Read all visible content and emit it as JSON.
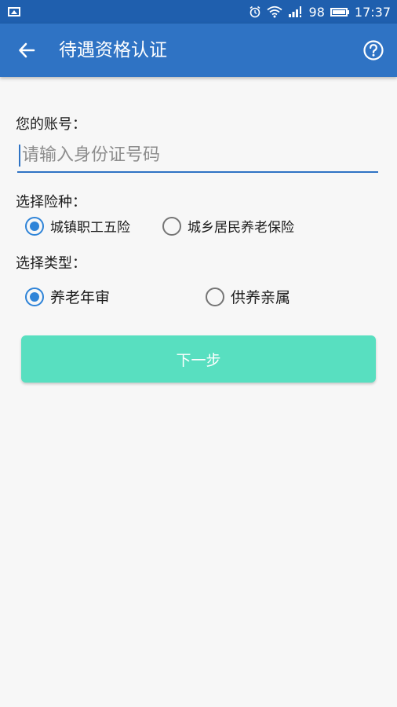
{
  "status_bar": {
    "battery_level": "98",
    "time": "17:37",
    "icons": [
      "image-icon",
      "alarm-icon",
      "wifi-icon",
      "signal-icon",
      "battery-icon"
    ]
  },
  "app_bar": {
    "title": "待遇资格认证",
    "icons": [
      "back-arrow-icon",
      "help-icon"
    ]
  },
  "account": {
    "label": "您的账号：",
    "placeholder": "请输入身份证号码",
    "value": ""
  },
  "insurance": {
    "label": "选择险种：",
    "options": [
      {
        "label": "城镇职工五险",
        "checked": true
      },
      {
        "label": "城乡居民养老保险",
        "checked": false
      }
    ]
  },
  "type": {
    "label": "选择类型：",
    "options": [
      {
        "label": "养老年审",
        "checked": true
      },
      {
        "label": "供养亲属",
        "checked": false
      }
    ]
  },
  "next_button": {
    "label": "下一步"
  },
  "colors": {
    "status_bar": "#1f5fae",
    "app_bar": "#2f73c4",
    "radio_checked": "#2f84d8",
    "button": "#58dfc0",
    "background": "#f7f7f7"
  }
}
